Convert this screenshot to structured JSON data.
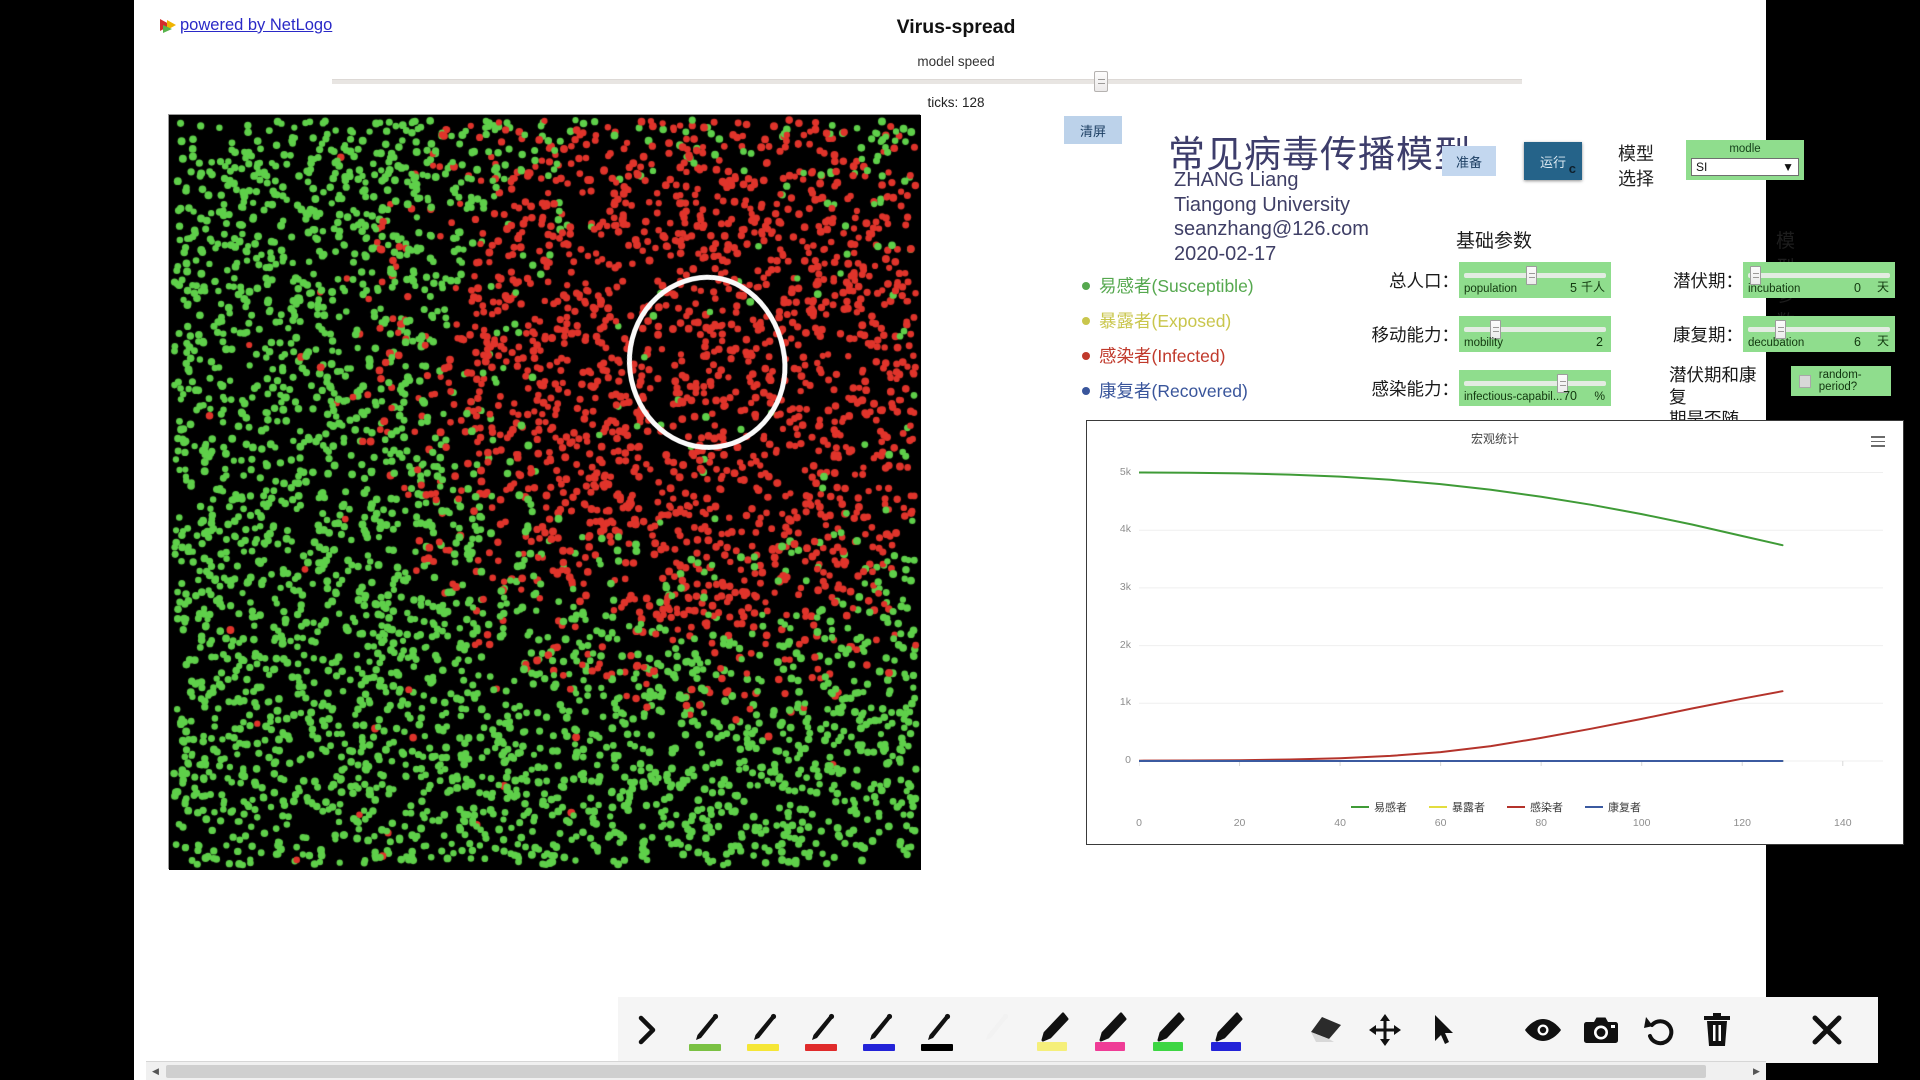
{
  "header": {
    "netlogo_link": "powered by NetLogo",
    "app_title": "Virus-spread",
    "speed_label": "model speed",
    "ticks": "ticks: 128"
  },
  "controls": {
    "clear_button": "清屏",
    "prepare_button": "准备",
    "run_button": "运行",
    "run_button_key": "c",
    "model_select_label": "模型\n选择",
    "model_select_label_line1": "模型",
    "model_select_label_line2": "选择",
    "chooser_name": "modle",
    "chooser_value": "SI",
    "chooser_arrow": "▼"
  },
  "titleblock": {
    "main_title": "常见病毒传播模型",
    "author": "ZHANG Liang",
    "affiliation": "Tiangong University",
    "email": "seanzhang@126.com",
    "date": "2020-02-17"
  },
  "legend": [
    {
      "label": "易感者(Susceptible)",
      "color": "#55a84e"
    },
    {
      "label": "暴露者(Exposed)",
      "color": "#c9c64c"
    },
    {
      "label": "感染者(Infected)",
      "color": "#c0392b"
    },
    {
      "label": "康复者(Recovered)",
      "color": "#39559b"
    }
  ],
  "basic_params": {
    "heading": "基础参数",
    "rows": [
      {
        "label": "总人口：",
        "slider_name": "population",
        "value": "5",
        "unit": "千人",
        "pos": 0.47
      },
      {
        "label": "移动能力：",
        "slider_name": "mobility",
        "value": "2",
        "unit": "",
        "pos": 0.2
      },
      {
        "label": "感染能力：",
        "slider_name": "infectious-capabil...",
        "value": "70",
        "unit": "%",
        "pos": 0.7
      }
    ]
  },
  "model_params": {
    "heading": "模型参数",
    "rows": [
      {
        "label": "潜伏期：",
        "slider_name": "incubation",
        "value": "0",
        "unit": "天",
        "pos": 0.02
      },
      {
        "label": "康复期：",
        "slider_name": "decubation",
        "value": "6",
        "unit": "天",
        "pos": 0.21
      }
    ],
    "switch_label_line1": "潜伏期和康复",
    "switch_label_line2": "期是否随机：",
    "switch_name": "random-period?"
  },
  "chart_data": {
    "type": "line",
    "title": "宏观统计",
    "xlabel": "",
    "ylabel": "",
    "xlim": [
      0,
      148
    ],
    "ylim": [
      0,
      5200
    ],
    "xticks": [
      0,
      20,
      40,
      60,
      80,
      100,
      120,
      140
    ],
    "xticklabels": [
      "0",
      "20",
      "40",
      "60",
      "80",
      "100",
      "120",
      "140"
    ],
    "yticks": [
      0,
      1000,
      2000,
      3000,
      4000,
      5000
    ],
    "yticklabels": [
      "0",
      "1k",
      "2k",
      "3k",
      "4k",
      "5k"
    ],
    "grid": true,
    "legend_position": "bottom",
    "x": [
      0,
      10,
      20,
      30,
      40,
      50,
      60,
      70,
      80,
      90,
      100,
      110,
      120,
      128
    ],
    "series": [
      {
        "name": "易感者",
        "color": "#3f9b37",
        "values": [
          5000,
          4995,
          4985,
          4965,
          4930,
          4875,
          4800,
          4700,
          4580,
          4440,
          4280,
          4100,
          3900,
          3740
        ]
      },
      {
        "name": "暴露者",
        "color": "#e3dd3f",
        "values": [
          0,
          0,
          0,
          0,
          0,
          0,
          0,
          0,
          0,
          0,
          0,
          0,
          0,
          0
        ]
      },
      {
        "name": "感染者",
        "color": "#b4332b",
        "values": [
          5,
          8,
          14,
          26,
          48,
          88,
          155,
          258,
          400,
          560,
          730,
          910,
          1080,
          1210
        ]
      },
      {
        "name": "康复者",
        "color": "#3b5aa0",
        "values": [
          0,
          0,
          0,
          0,
          0,
          0,
          0,
          0,
          0,
          0,
          0,
          0,
          0,
          0
        ]
      }
    ]
  },
  "toolbar": {
    "items": [
      {
        "name": "pointer-arrow-tool",
        "icon": "chevron"
      },
      {
        "name": "pen-green-tool",
        "icon": "pen",
        "color": "#7ac143"
      },
      {
        "name": "pen-yellow-tool",
        "icon": "pen",
        "color": "#f5e636"
      },
      {
        "name": "pen-red-tool",
        "icon": "pen",
        "color": "#e02b2b"
      },
      {
        "name": "pen-blue-tool",
        "icon": "pen",
        "color": "#2323d8"
      },
      {
        "name": "pen-black-tool",
        "icon": "pen",
        "color": "#000000"
      },
      {
        "name": "pen-white-tool",
        "icon": "pen-white",
        "color": "#ffffff"
      },
      {
        "name": "marker-yellow-tool",
        "icon": "marker",
        "color": "#f5ef7a"
      },
      {
        "name": "marker-pink-tool",
        "icon": "marker",
        "color": "#ef3c96"
      },
      {
        "name": "marker-green-tool",
        "icon": "marker",
        "color": "#3dd643"
      },
      {
        "name": "marker-blue-tool",
        "icon": "marker",
        "color": "#2323d8"
      },
      {
        "name": "eraser-tool",
        "icon": "eraser"
      },
      {
        "name": "move-tool",
        "icon": "move"
      },
      {
        "name": "select-cursor-tool",
        "icon": "cursor"
      },
      {
        "name": "visibility-tool",
        "icon": "eye"
      },
      {
        "name": "screenshot-tool",
        "icon": "camera"
      },
      {
        "name": "undo-tool",
        "icon": "undo"
      },
      {
        "name": "delete-tool",
        "icon": "trash"
      },
      {
        "name": "close-toolbar",
        "icon": "close"
      }
    ]
  }
}
